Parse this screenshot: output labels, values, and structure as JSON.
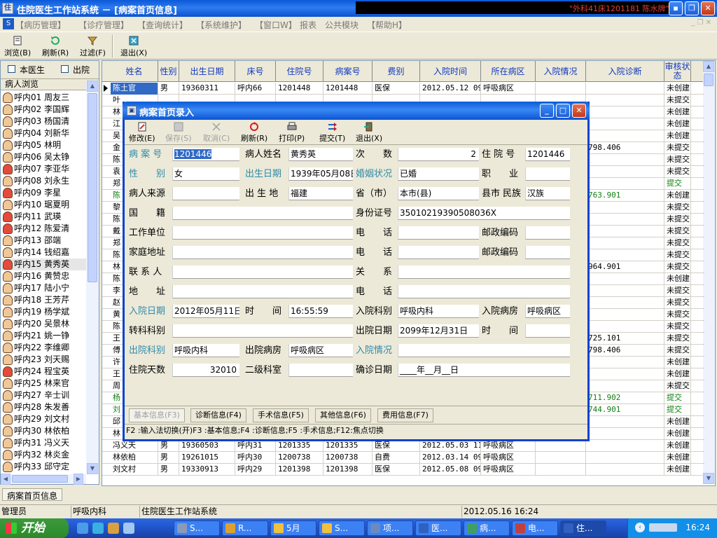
{
  "window": {
    "title": "住院医生工作站系统 － [病案首页信息]",
    "user_info": "\"外科41床1201181 陈水牌\" ··"
  },
  "menu": [
    "【病历管理】",
    "【诊疗管理】",
    "【查询统计】",
    "【系统维护】",
    "【窗口W】",
    "报表",
    "公共模块",
    "【帮助H】"
  ],
  "toolbar": [
    "浏览(B)",
    "刷新(R)",
    "过滤(F)",
    "退出(X)"
  ],
  "left_panel": {
    "checkboxes": [
      "本医生",
      "出院"
    ],
    "header": "病人浏览",
    "patients": [
      {
        "label": "呼内01 周友三",
        "f": false
      },
      {
        "label": "呼内02 李国辉",
        "f": false
      },
      {
        "label": "呼内03 杨国清",
        "f": false
      },
      {
        "label": "呼内04 刘新华",
        "f": false
      },
      {
        "label": "呼内05 林明",
        "f": false
      },
      {
        "label": "呼内06 吴太铮",
        "f": false
      },
      {
        "label": "呼内07 李亚华",
        "f": true
      },
      {
        "label": "呼内08 刘永生",
        "f": false
      },
      {
        "label": "呼内09 李星",
        "f": true
      },
      {
        "label": "呼内10 琚夏明",
        "f": false
      },
      {
        "label": "呼内11 武瑛",
        "f": true
      },
      {
        "label": "呼内12 陈爱清",
        "f": true
      },
      {
        "label": "呼内13 邵端",
        "f": false
      },
      {
        "label": "呼内14 钱绍嘉",
        "f": false
      },
      {
        "label": "呼内15 黄秀英",
        "f": true,
        "sel": true
      },
      {
        "label": "呼内16 黄赞忠",
        "f": false
      },
      {
        "label": "呼内17 陆小宁",
        "f": false
      },
      {
        "label": "呼内18 王芳芹",
        "f": false
      },
      {
        "label": "呼内19 杨学斌",
        "f": false
      },
      {
        "label": "呼内20 吴景林",
        "f": false
      },
      {
        "label": "呼内21 姚一铮",
        "f": false
      },
      {
        "label": "呼内22 李维卿",
        "f": false
      },
      {
        "label": "呼内23 刘天赐",
        "f": false
      },
      {
        "label": "呼内24 程宝英",
        "f": true
      },
      {
        "label": "呼内25 林来官",
        "f": false
      },
      {
        "label": "呼内27 辛士训",
        "f": false
      },
      {
        "label": "呼内28 朱发善",
        "f": false
      },
      {
        "label": "呼内29 刘文村",
        "f": false
      },
      {
        "label": "呼内30 林依柏",
        "f": false
      },
      {
        "label": "呼内31 冯义天",
        "f": false
      },
      {
        "label": "呼内32 林炎金",
        "f": false
      },
      {
        "label": "呼内33 邱守定",
        "f": false
      }
    ]
  },
  "grid": {
    "columns": [
      "姓名",
      "性别",
      "出生日期",
      "床号",
      "住院号",
      "病案号",
      "费别",
      "入院时间",
      "所在病区",
      "入院情况",
      "入院诊断",
      "审核状态"
    ],
    "rows_top": [
      [
        "陈土官",
        "男",
        "19360311",
        "呼内66",
        "1201448",
        "1201448",
        "医保",
        "2012.05.12 09",
        "呼吸病区",
        "",
        "",
        "未创建"
      ],
      [
        "叶",
        "",
        "",
        "",
        "",
        "",
        "",
        "",
        "",
        "",
        "",
        "未提交"
      ]
    ],
    "side_rows": [
      [
        "林",
        ""
      ],
      [
        "江",
        ""
      ],
      [
        "吴",
        ""
      ],
      [
        "金",
        "798.406"
      ],
      [
        "陈",
        ""
      ],
      [
        "袁",
        ""
      ],
      [
        "郑",
        ""
      ],
      [
        "陈",
        "763.901"
      ],
      [
        "黎",
        ""
      ],
      [
        "陈",
        ""
      ],
      [
        "戴",
        ""
      ],
      [
        "郑",
        ""
      ],
      [
        "陈",
        ""
      ],
      [
        "林",
        "964.901"
      ],
      [
        "陈",
        ""
      ],
      [
        "李",
        ""
      ],
      [
        "赵",
        ""
      ],
      [
        "黄",
        ""
      ],
      [
        "陈",
        ""
      ],
      [
        "王",
        "725.101"
      ],
      [
        "傅",
        "798.406"
      ],
      [
        "许",
        ""
      ],
      [
        "王",
        ""
      ],
      [
        "周",
        ""
      ],
      [
        "杨",
        "711.902"
      ],
      [
        "刘",
        "744.901"
      ],
      [
        "邱",
        ""
      ],
      [
        "林",
        ""
      ]
    ],
    "status_col": [
      "未创建",
      "未创建",
      "未创建",
      "未提交",
      "未提交",
      "未提交",
      "提交",
      "未创建",
      "未提交",
      "未提交",
      "未提交",
      "未提交",
      "未提交",
      "未提交",
      "未创建",
      "未提交",
      "未提交",
      "未提交",
      "未提交",
      "未提交",
      "未提交",
      "未创建",
      "未创建",
      "未提交",
      "提交",
      "提交",
      "未创建",
      "未创建"
    ],
    "rows_bottom": [
      [
        "冯义天",
        "男",
        "19360503",
        "呼内31",
        "1201335",
        "1201335",
        "医保",
        "2012.05.03 11",
        "呼吸病区",
        "",
        "",
        "未创建"
      ],
      [
        "林依柏",
        "男",
        "19261015",
        "呼内30",
        "1200738",
        "1200738",
        "自费",
        "2012.03.14 09",
        "呼吸病区",
        "",
        "",
        "未创建"
      ],
      [
        "刘文村",
        "男",
        "19330913",
        "呼内29",
        "1201398",
        "1201398",
        "医保",
        "2012.05.08 09",
        "呼吸病区",
        "",
        "",
        "未创建"
      ]
    ]
  },
  "dialog": {
    "title": "病案首页录入",
    "tools": [
      "修改(E)",
      "保存(S)",
      "取消(C)",
      "刷新(R)",
      "打印(P)",
      "提交(T)",
      "退出(X)"
    ],
    "labels": {
      "bah": "病 案 号",
      "name": "病人姓名",
      "cs": "次　　数",
      "zyh": "住 院 号",
      "xb": "性　　别",
      "csrq": "出生日期",
      "hyzk": "婚姻状况",
      "zy": "职　　业",
      "brly": "病人来源",
      "csd": "出 生 地",
      "sheng": "省（市）",
      "xian": "县市",
      "mz": "民族",
      "gj": "国　　籍",
      "sfz": "身份证号",
      "gzdw": "工作单位",
      "dh1": "电　　话",
      "yb1": "邮政编码",
      "jtdz": "家庭地址",
      "dh2": "电　　话",
      "yb2": "邮政编码",
      "lxr": "联 系 人",
      "gx": "关　　系",
      "dz": "地　　址",
      "dh3": "电　　话",
      "ryrq": "入院日期",
      "sj": "时　　间",
      "ryks": "入院科别",
      "rybf": "入院病房",
      "zkkb": "转科科别",
      "cyrq": "出院日期",
      "sj2": "时　　间",
      "cyks": "出院科别",
      "cybf": "出院病房",
      "rycq": "入院情况",
      "zyts": "住院天数",
      "ejks": "二级科室",
      "qzrq": "确诊日期"
    },
    "values": {
      "bah": "1201446",
      "name": "黄秀英",
      "cs": "2",
      "zyh": "1201446",
      "xb": "女",
      "csrq": "1939年05月08日",
      "hyzk": "已婚",
      "zy": "",
      "brly": "",
      "csd": "福建",
      "sheng": "本市(县)",
      "mz": "汉族",
      "gj": "",
      "sfz": "35010219390508036X",
      "ryrq": "2012年05月11日",
      "sj": "16:55:59",
      "ryks": "呼吸内科",
      "rybf": "呼吸病区",
      "cyrq": "2099年12月31日",
      "cyks": "呼吸内科",
      "cybf": "呼吸病区",
      "zyts": "32010",
      "qzrq": "____年__月__日"
    },
    "tabs": [
      "基本信息(F3)",
      "诊断信息(F4)",
      "手术信息(F5)",
      "其他信息(F6)",
      "费用信息(F7)"
    ],
    "status": "F2 :输入法切换(开)F3 :基本信息;F4 :诊断信息;F5 :手术信息;F12:焦点切换"
  },
  "bottom_tab": "病案首页信息",
  "statusbar": [
    "管理员",
    "呼吸内科",
    "住院医生工作站系统",
    "2012.05.16 16:24"
  ],
  "taskbar": {
    "start": "开始",
    "tasks": [
      "S...",
      "R...",
      "5月",
      "S...",
      "项...",
      "医...",
      "病...",
      "电...",
      "住..."
    ],
    "clock": "16:24"
  },
  "colors": {
    "title_blue": "#0A59D8",
    "header_text": "#1038C0",
    "label_blue": "#2E8BAA",
    "approved": "#108010"
  }
}
